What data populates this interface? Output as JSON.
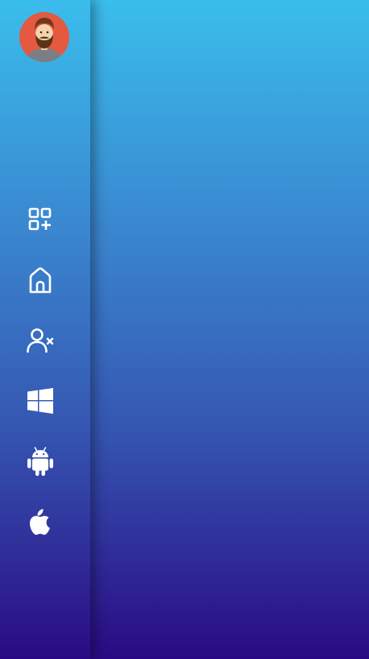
{
  "colors": {
    "gradient_top": "#3abdec",
    "gradient_mid": "#3556b2",
    "gradient_bottom": "#2a0a84",
    "avatar_bg": "#e4593f",
    "icon_color": "#ffffff"
  },
  "sidebar": {
    "avatar": {
      "icon": "bearded-man-avatar"
    },
    "items": [
      {
        "id": "dashboard",
        "icon": "grid-add-icon"
      },
      {
        "id": "home",
        "icon": "home-icon"
      },
      {
        "id": "remove-user",
        "icon": "user-remove-icon"
      },
      {
        "id": "windows",
        "icon": "windows-icon"
      },
      {
        "id": "android",
        "icon": "android-icon"
      },
      {
        "id": "apple",
        "icon": "apple-icon"
      }
    ]
  }
}
